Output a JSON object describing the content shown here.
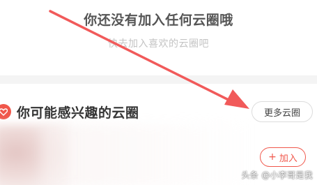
{
  "empty_state": {
    "title": "你还没有加入任何云圈哦",
    "subtitle": "快去加入喜欢的云圈吧"
  },
  "recommend": {
    "title": "你可能感兴趣的云圈",
    "more_label": "更多云圈",
    "join_label": "加入",
    "join_icon": "plus-icon"
  },
  "watermark": "头条 @小李哥是我",
  "colors": {
    "accent": "#f0574b",
    "arrow": "#f15a5a"
  },
  "icons": {
    "section": "heart-icon"
  }
}
